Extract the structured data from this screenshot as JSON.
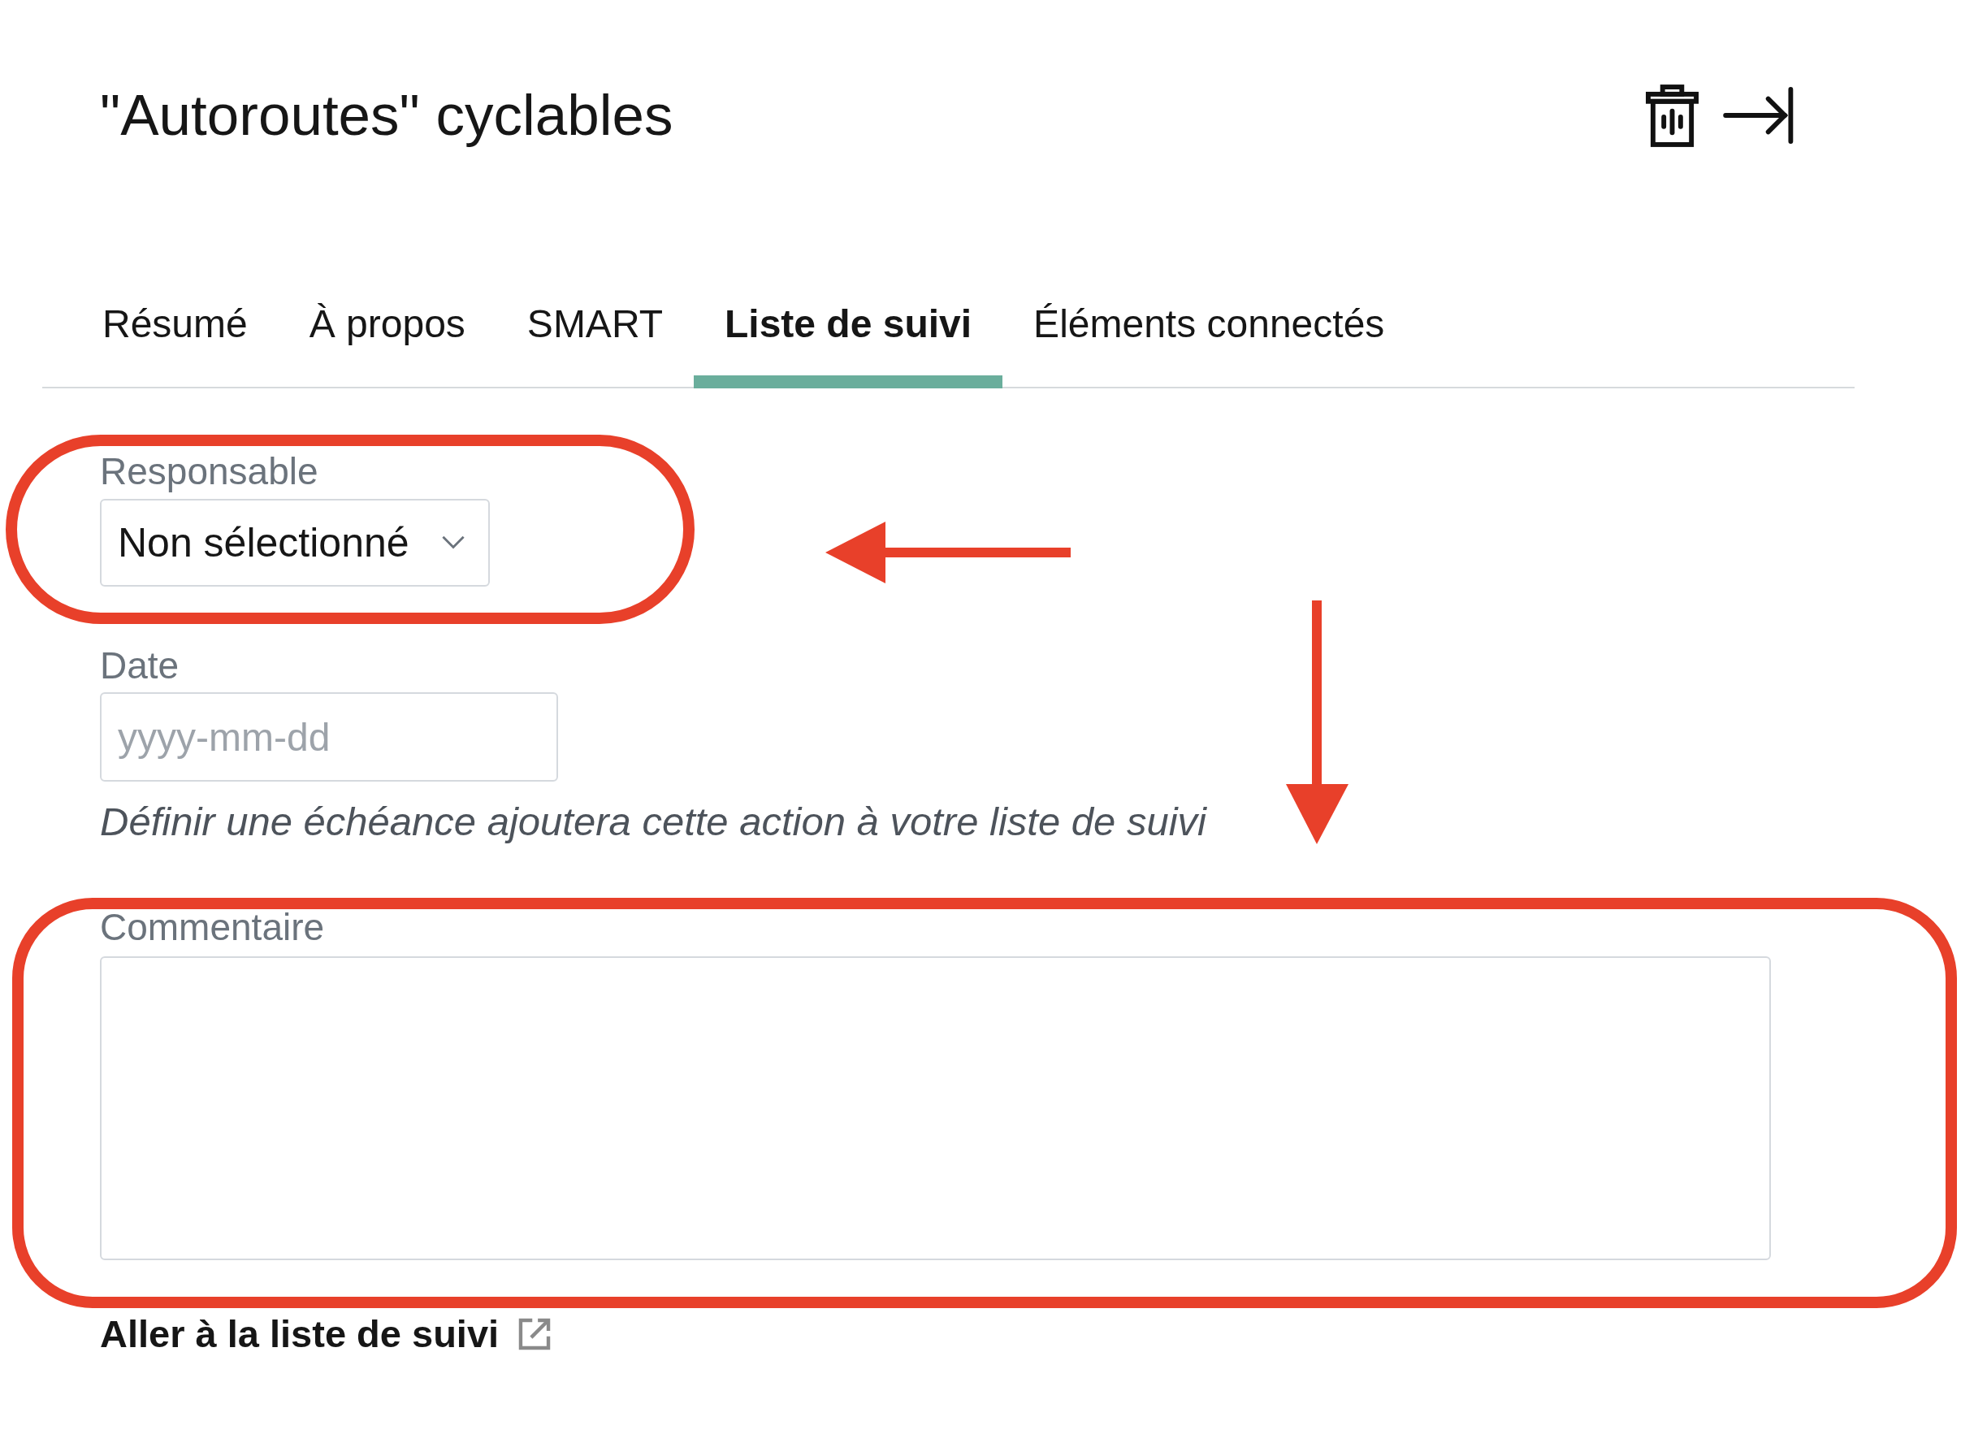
{
  "header": {
    "title": "\"Autoroutes\" cyclables"
  },
  "tabs": [
    {
      "label": "Résumé",
      "selected": false
    },
    {
      "label": "À propos",
      "selected": false
    },
    {
      "label": "SMART",
      "selected": false
    },
    {
      "label": "Liste de suivi",
      "selected": true
    },
    {
      "label": "Éléments connectés",
      "selected": false
    }
  ],
  "form": {
    "fields": [
      {
        "kind": "select",
        "label": "Responsable",
        "value": "Non sélectionné"
      },
      {
        "kind": "date",
        "label": "Date",
        "placeholder": "yyyy-mm-dd",
        "hint": "Définir une échéance ajoutera cette action à votre liste de suivi"
      },
      {
        "kind": "textarea",
        "label": "Commentaire"
      }
    ]
  },
  "link": {
    "label": "Aller à la liste de suivi"
  },
  "annotations": [
    {
      "kind": "outline"
    },
    {
      "kind": "arrow_left"
    },
    {
      "kind": "arrow_down"
    },
    {
      "kind": "outline"
    }
  ]
}
